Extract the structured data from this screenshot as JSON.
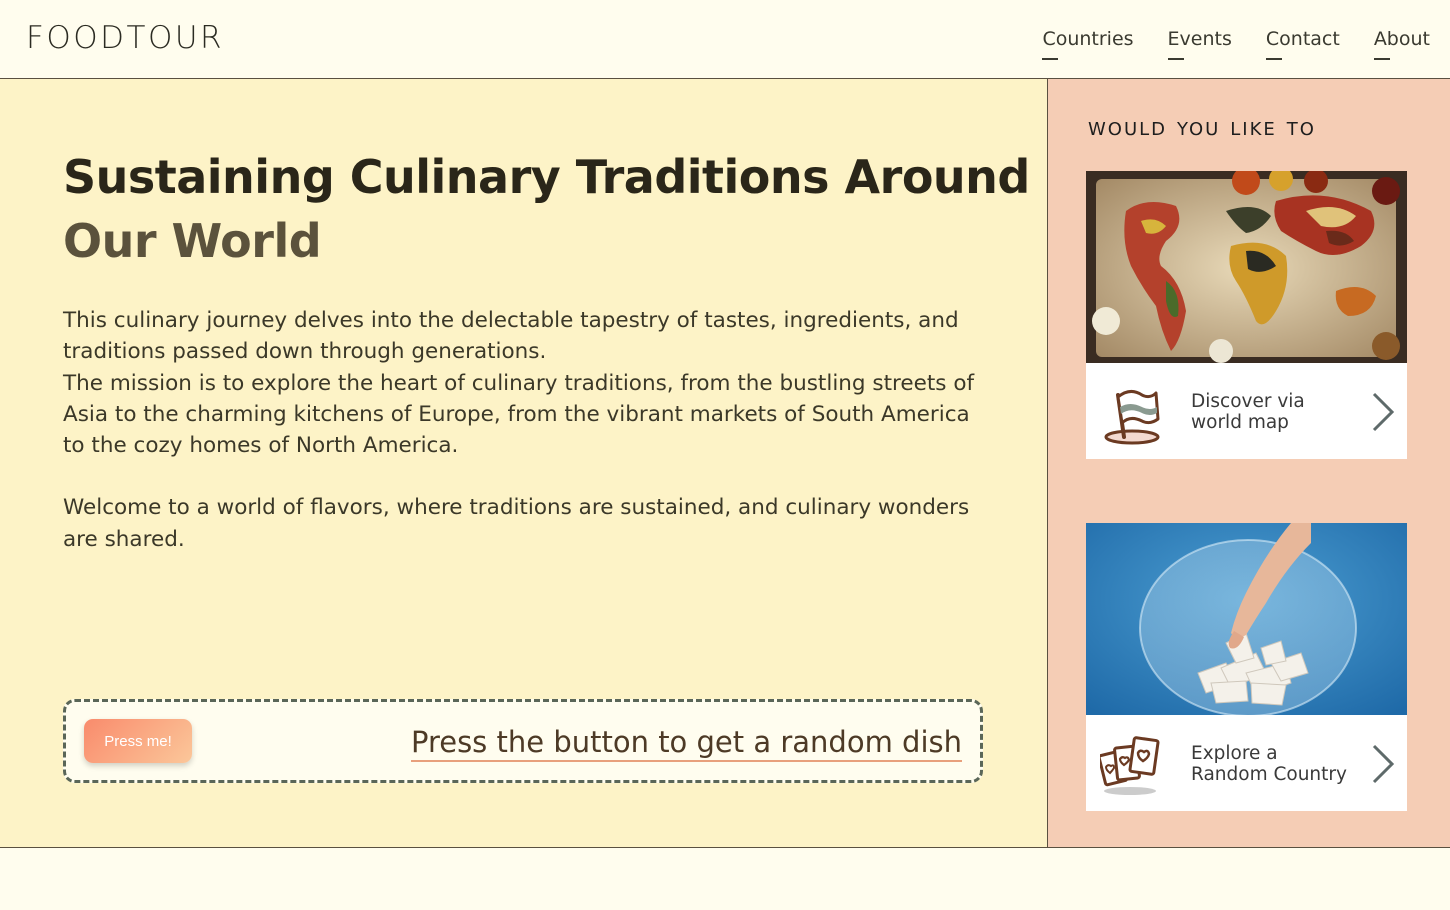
{
  "header": {
    "logo": "FOODTOUR",
    "nav": [
      "Countries",
      "Events",
      "Contact",
      "About"
    ]
  },
  "main": {
    "title_line1": "Sustaining Culinary Traditions Around",
    "title_line2": "Our World",
    "paragraph1": "This culinary journey delves into the delectable tapestry of tastes, ingredients, and traditions passed down through generations.",
    "paragraph2": "The mission is to explore the heart of culinary traditions, from the bustling streets of Asia to the charming kitchens of Europe, from the vibrant markets of South America to the cozy homes of North America.",
    "paragraph3": "Welcome to a world of flavors, where traditions are sustained, and culinary wonders are shared.",
    "random": {
      "button_label": "Press me!",
      "prompt": "Press the button to get a random dish"
    }
  },
  "sidebar": {
    "title": "would you like to",
    "cards": [
      {
        "label_line1": "Discover via",
        "label_line2": "world map",
        "icon": "flag-icon"
      },
      {
        "label_line1": "Explore a",
        "label_line2": "Random Country",
        "icon": "cards-icon"
      }
    ]
  },
  "colors": {
    "main_bg": "#fdf3c7",
    "sidebar_bg": "#f5cdb5",
    "page_bg": "#fffdee",
    "accent": "#f98b6c",
    "icon_brown": "#6b3a22"
  }
}
